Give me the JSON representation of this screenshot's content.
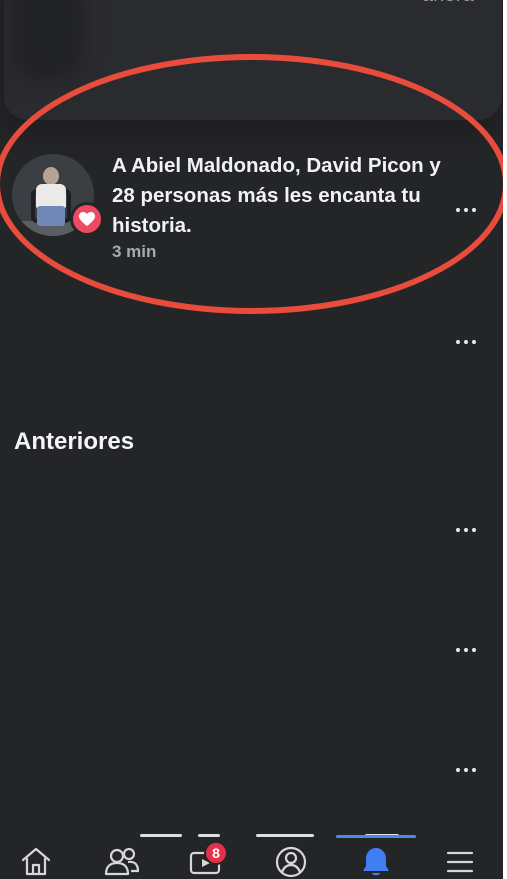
{
  "header": {
    "time": "ahora"
  },
  "notifications": [
    {
      "text": "A Abiel Maldonado, David Picon y 28 personas más les encanta tu historia.",
      "time": "3 min",
      "reaction": "heart-icon",
      "menu": "more-options-icon"
    }
  ],
  "sections": {
    "earlier_title": "Anteriores"
  },
  "tabbar": {
    "items": [
      {
        "name": "home",
        "icon": "home-icon"
      },
      {
        "name": "friends",
        "icon": "friends-icon"
      },
      {
        "name": "watch",
        "icon": "video-icon",
        "badge": "8"
      },
      {
        "name": "profile",
        "icon": "profile-icon"
      },
      {
        "name": "notifications",
        "icon": "bell-icon",
        "active": true
      },
      {
        "name": "menu",
        "icon": "menu-icon"
      }
    ]
  },
  "colors": {
    "background": "#242527",
    "annotation": "#e74c3c",
    "accent": "#4d89e8",
    "badge": "#e4314a",
    "heart": "#ed4b63"
  }
}
